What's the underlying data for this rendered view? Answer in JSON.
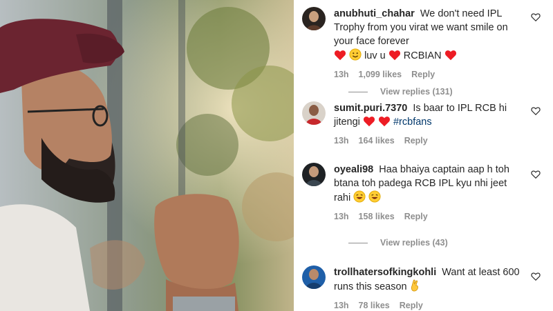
{
  "comments": [
    {
      "username": "anubhuti_chahar",
      "text": "We don't need IPL Trophy from you virat we want smile on your face forever",
      "text_tail_1": "luv u",
      "text_tail_2": "RCBIAN",
      "time": "13h",
      "likes": "1,099 likes",
      "reply": "Reply",
      "view_replies": "View replies (131)"
    },
    {
      "username": "sumit.puri.7370",
      "text": "Is baar to IPL RCB hi jitengi",
      "hashtag": "#rcbfans",
      "time": "13h",
      "likes": "164 likes",
      "reply": "Reply"
    },
    {
      "username": "oyeali98",
      "text": "Haa bhaiya captain aap h toh btana toh padega RCB IPL kyu nhi jeet rahi",
      "time": "13h",
      "likes": "158 likes",
      "reply": "Reply",
      "view_replies": "View replies (43)"
    },
    {
      "username": "trollhatersofkingkohli",
      "text": "Want at least 600 runs this season",
      "time": "13h",
      "likes": "78 likes",
      "reply": "Reply"
    }
  ],
  "colors": {
    "heart_red": "#ed1c24",
    "meta_gray": "#8e8e8e",
    "text": "#262626",
    "link": "#00376b"
  },
  "icons": [
    "heart-outline-icon",
    "red-heart-emoji",
    "smile-emoji",
    "laughing-emoji",
    "fingers-crossed-emoji"
  ]
}
